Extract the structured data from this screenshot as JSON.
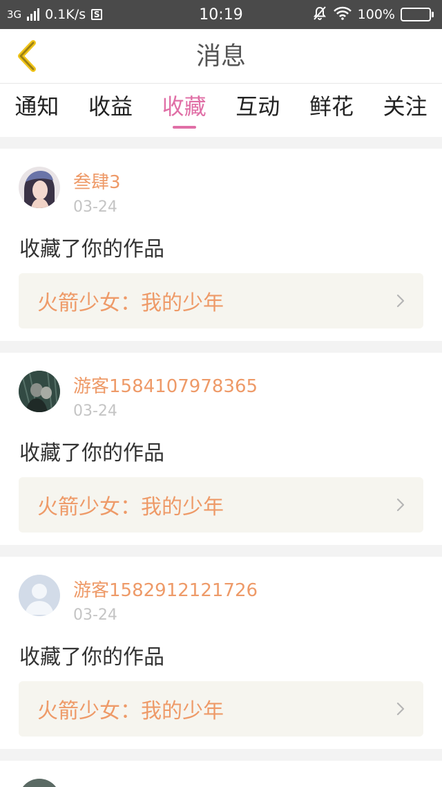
{
  "status_bar": {
    "network_type": "3G",
    "speed": "0.1K/s",
    "s_badge": "S",
    "time": "10:19",
    "battery": "100%"
  },
  "header": {
    "title": "消息"
  },
  "tabs": [
    {
      "label": "通知",
      "active": false
    },
    {
      "label": "收益",
      "active": false
    },
    {
      "label": "收藏",
      "active": true
    },
    {
      "label": "互动",
      "active": false
    },
    {
      "label": "鲜花",
      "active": false
    },
    {
      "label": "关注",
      "active": false
    }
  ],
  "messages": [
    {
      "username": "叁肆3",
      "date": "03-24",
      "action": "收藏了你的作品",
      "work_title": "火箭少女：我的少年"
    },
    {
      "username": "游客1584107978365",
      "date": "03-24",
      "action": "收藏了你的作品",
      "work_title": "火箭少女：我的少年"
    },
    {
      "username": "游客1582912121726",
      "date": "03-24",
      "action": "收藏了你的作品",
      "work_title": "火箭少女：我的少年"
    }
  ],
  "colors": {
    "accent_pink": "#e06fa6",
    "username_orange": "#ee9a68",
    "back_arrow_yellow": "#f0c41a"
  }
}
